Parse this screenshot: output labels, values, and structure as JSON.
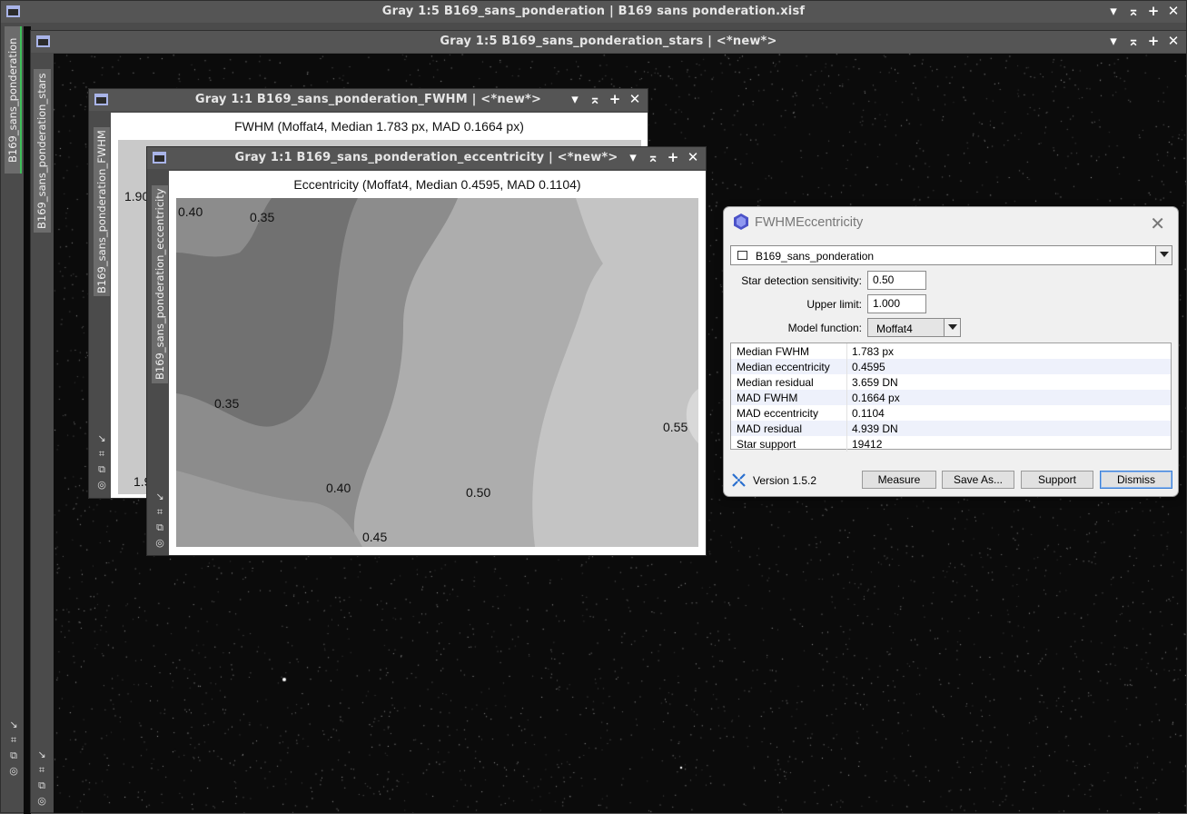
{
  "windows": {
    "main": {
      "title": "Gray 1:5 B169_sans_ponderation | B169 sans ponderation.xisf",
      "side_tab": "B169_sans_ponderation"
    },
    "stars": {
      "title": "Gray 1:5 B169_sans_ponderation_stars | <*new*>",
      "side_tab": "B169_sans_ponderation_stars"
    },
    "fwhm": {
      "title": "Gray 1:1 B169_sans_ponderation_FWHM | <*new*>",
      "side_tab": "B169_sans_ponderation_FWHM",
      "plot_title": "FWHM (Moffat4, Median 1.783 px, MAD 0.1664 px)",
      "labels": [
        "1.90",
        "1.9"
      ]
    },
    "eccentricity": {
      "title": "Gray 1:1 B169_sans_ponderation_eccentricity | <*new*>",
      "side_tab": "B169_sans_ponderation_eccentricity",
      "plot_title": "Eccentricity (Moffat4, Median 0.4595, MAD 0.1104)",
      "contour_labels": [
        "0.40",
        "0.35",
        "0.35",
        "0.55",
        "0.40",
        "0.50",
        "0.45"
      ]
    },
    "buttons": {
      "shade": "▾",
      "minimize": "⌅",
      "maximize": "+",
      "close": "✕"
    },
    "side_icons": [
      "↘",
      "⌗",
      "⧉",
      "◎"
    ]
  },
  "dialog": {
    "title": "FWHMEccentricity",
    "close_icon": "✕",
    "image_select": "B169_sans_ponderation",
    "sensitivity_label": "Star detection sensitivity:",
    "sensitivity_value": "0.50",
    "upper_limit_label": "Upper limit:",
    "upper_limit_value": "1.000",
    "model_label": "Model function:",
    "model_value": "Moffat4",
    "results": [
      {
        "label": "Median FWHM",
        "value": "1.783 px"
      },
      {
        "label": "Median eccentricity",
        "value": "0.4595"
      },
      {
        "label": "Median residual",
        "value": "3.659 DN"
      },
      {
        "label": "MAD FWHM",
        "value": "0.1664 px"
      },
      {
        "label": "MAD eccentricity",
        "value": "0.1104"
      },
      {
        "label": "MAD residual",
        "value": "4.939 DN"
      },
      {
        "label": "Star support",
        "value": "19412"
      }
    ],
    "version": "Version 1.5.2",
    "buttons": {
      "measure": "Measure",
      "save_as": "Save As...",
      "support": "Support",
      "dismiss": "Dismiss"
    }
  },
  "colors": {
    "accent": "#3c7fd6",
    "window_chrome": "#555555",
    "pi_icon": "#4b52c8"
  }
}
